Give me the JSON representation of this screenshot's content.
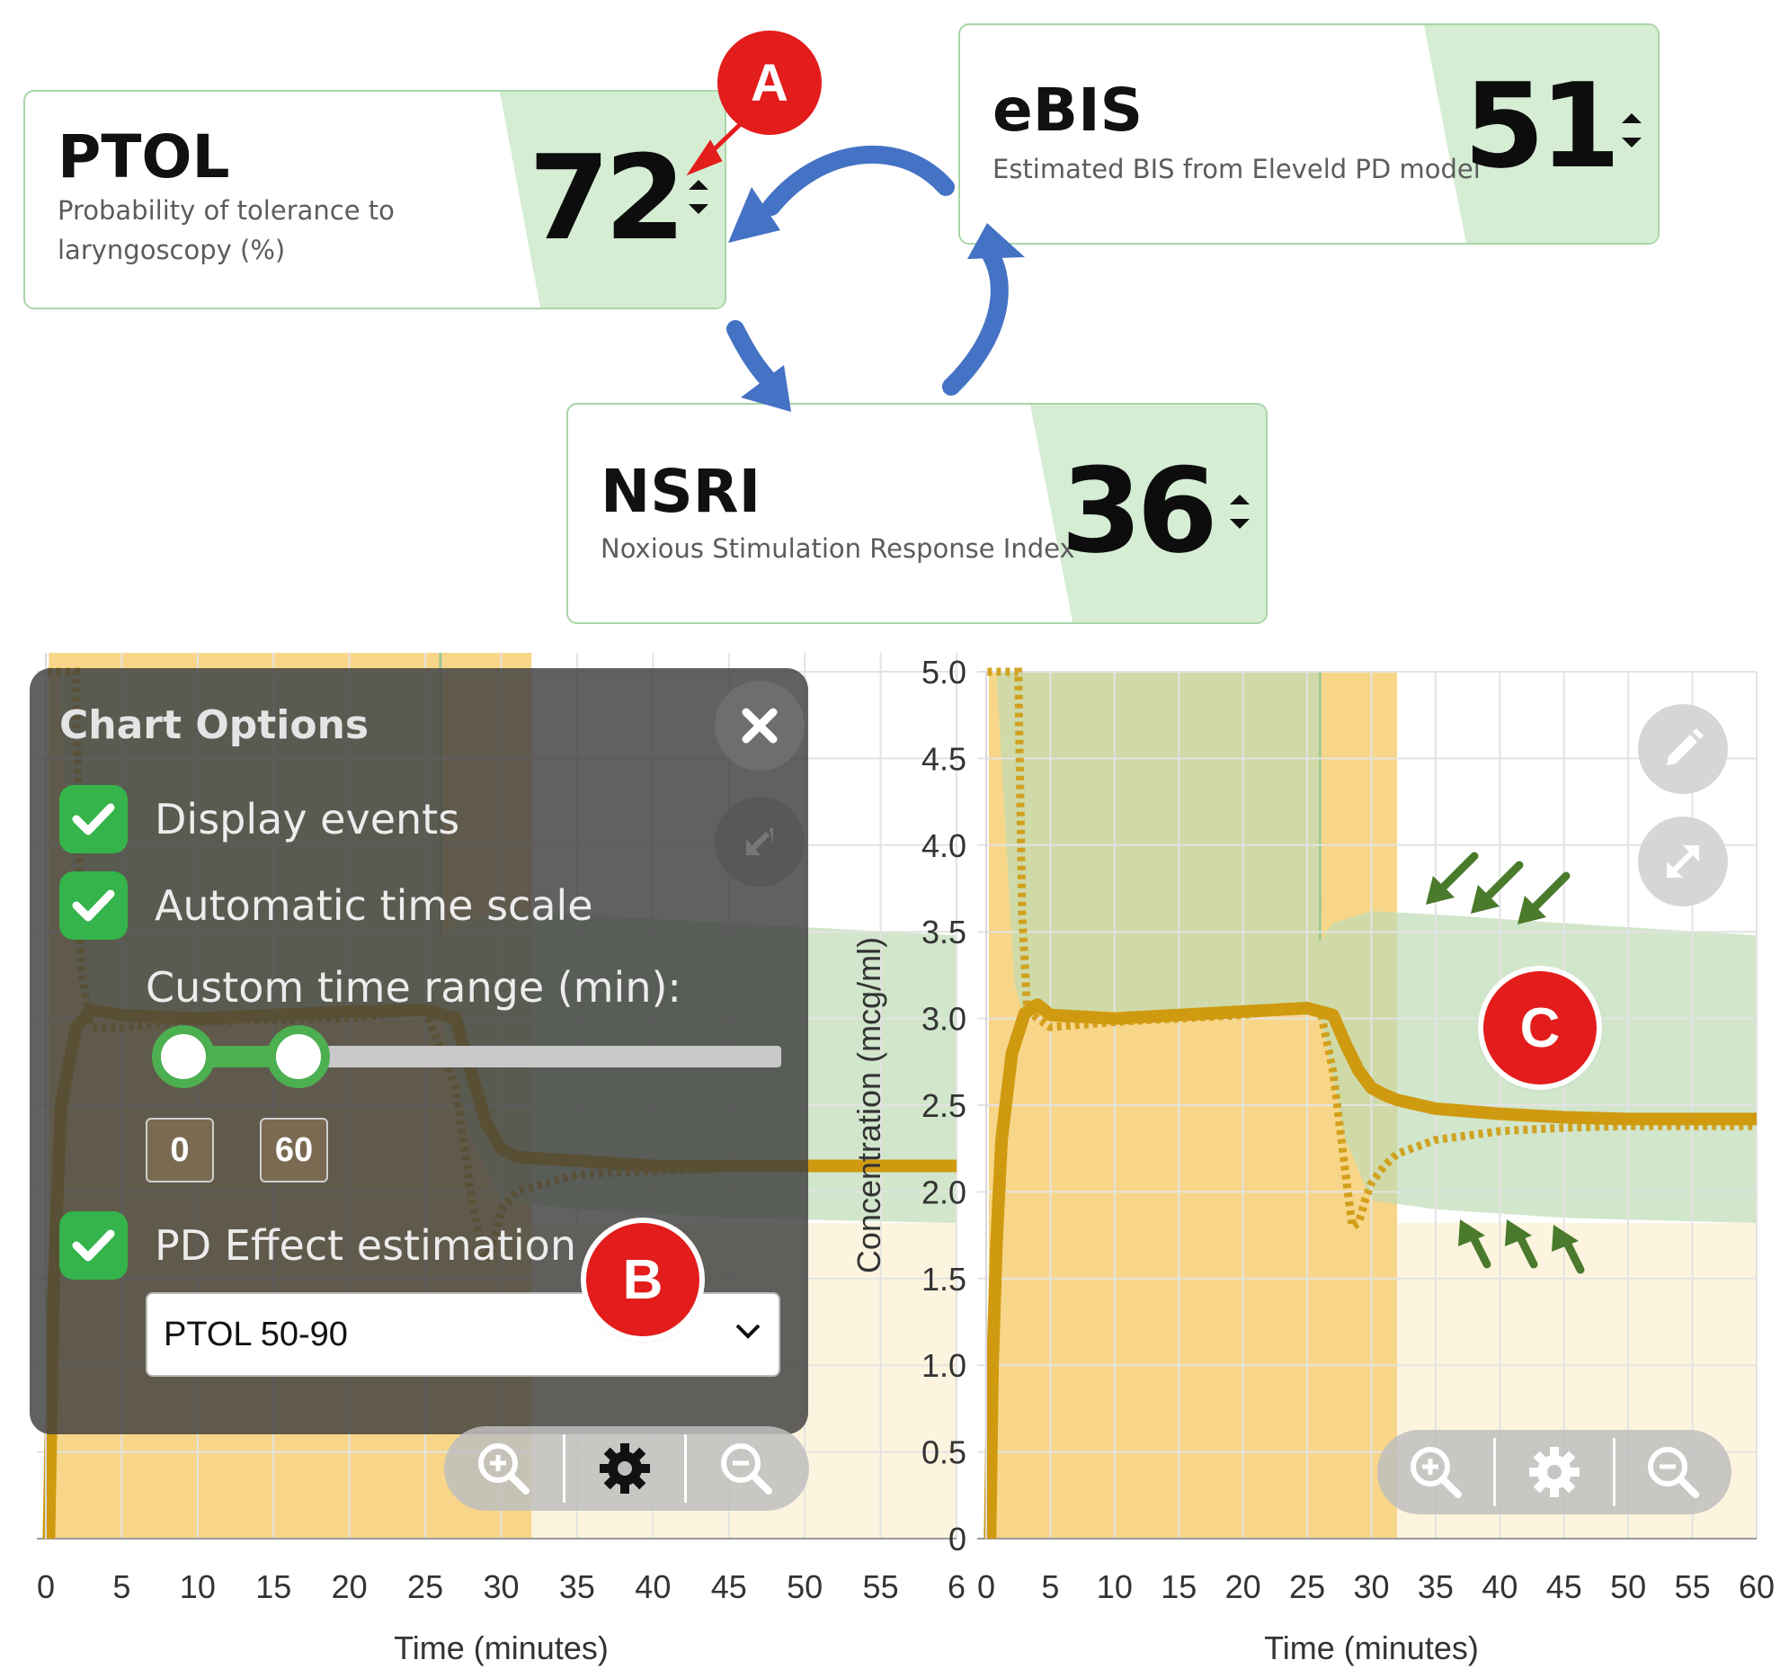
{
  "metrics": {
    "ptol": {
      "title": "PTOL",
      "subtitle_line1": "Probability of tolerance to",
      "subtitle_line2": "laryngoscopy (%)",
      "value": "72"
    },
    "ebis": {
      "title": "eBIS",
      "subtitle": "Estimated BIS from Eleveld PD model",
      "value": "51"
    },
    "nsri": {
      "title": "NSRI",
      "subtitle": "Noxious Stimulation Response Index",
      "value": "36"
    }
  },
  "callouts": {
    "a": "A",
    "b": "B",
    "c": "C"
  },
  "chart_options": {
    "title": "Chart Options",
    "display_events": "Display events",
    "automatic_time_scale": "Automatic time scale",
    "custom_time_range": "Custom time range (min):",
    "range_min": "0",
    "range_max": "60",
    "pd_effect_estimation": "PD Effect estimation",
    "pd_select_value": "PTOL 50-90"
  },
  "icons": {
    "close": "close-icon",
    "pencil": "pencil-icon",
    "expand": "expand-icon",
    "zoom_in": "zoom-in-icon",
    "gear": "gear-icon",
    "zoom_out": "zoom-out-icon",
    "check": "check-icon",
    "chevron": "chevron-down-icon"
  },
  "colors": {
    "card_border": "#a9d5a7",
    "card_green": "#d5edd3",
    "badge_red": "#e31c1c",
    "arrow_blue": "#4472c4",
    "band_green": "#bddcb5",
    "infusion_orange": "#f6cf74",
    "cp_line": "#cf9a10",
    "ce_line": "#f4c23c",
    "checkbox_green": "#34b44a",
    "hint_arrow": "#4a7a2c"
  },
  "chart_data": [
    {
      "type": "line",
      "xlabel": "Time (minutes)",
      "ylabel": "",
      "xlim": [
        0,
        60
      ],
      "x_ticks": [
        "0",
        "5",
        "10",
        "15",
        "20",
        "25",
        "30",
        "35",
        "40",
        "45",
        "50",
        "55",
        "6"
      ],
      "series": [
        {
          "x": [
            0.2,
            0.5,
            1,
            2,
            3,
            5,
            10,
            15,
            20,
            25,
            27,
            28,
            29,
            30,
            31,
            35,
            40,
            50,
            60
          ],
          "y": [
            0,
            1.4,
            2.5,
            2.95,
            3.05,
            3.02,
            3.0,
            3.02,
            3.04,
            3.05,
            3.0,
            2.7,
            2.4,
            2.25,
            2.2,
            2.18,
            2.15,
            2.15,
            2.15
          ]
        },
        {
          "x": [
            0.1,
            2,
            2.3,
            3,
            5,
            10,
            20,
            25,
            27,
            28,
            28.5,
            29,
            29.5,
            30,
            31,
            35,
            40,
            50,
            60
          ],
          "y": [
            5.0,
            5.0,
            3.3,
            2.95,
            2.95,
            2.98,
            3.0,
            3.05,
            2.6,
            2.0,
            1.75,
            1.6,
            1.7,
            1.9,
            2.0,
            2.1,
            2.12,
            2.15,
            2.15
          ]
        }
      ]
    },
    {
      "type": "line",
      "xlabel": "Time (minutes)",
      "ylabel": "Concentration (mcg/ml)",
      "xlim": [
        0,
        60
      ],
      "ylim": [
        0,
        5.0
      ],
      "x_ticks": [
        "0",
        "5",
        "10",
        "15",
        "20",
        "25",
        "30",
        "35",
        "40",
        "45",
        "50",
        "55",
        "60"
      ],
      "y_ticks": [
        "0",
        "0.5",
        "1.0",
        "1.5",
        "2.0",
        "2.5",
        "3.0",
        "3.5",
        "4.0",
        "4.5",
        "5.0"
      ],
      "series": [
        {
          "x": [
            0.3,
            0.5,
            0.8,
            1.2,
            2,
            3,
            4,
            5,
            10,
            15,
            20,
            25,
            27,
            28,
            29,
            30,
            31,
            32,
            35,
            40,
            45,
            50,
            55,
            60
          ],
          "y": [
            0,
            1.0,
            1.7,
            2.3,
            2.8,
            3.03,
            3.08,
            3.02,
            3.0,
            3.02,
            3.04,
            3.06,
            3.02,
            2.85,
            2.7,
            2.6,
            2.56,
            2.53,
            2.48,
            2.45,
            2.43,
            2.42,
            2.42,
            2.42
          ]
        },
        {
          "x": [
            0.1,
            2.5,
            2.8,
            3.2,
            4,
            5,
            10,
            20,
            25,
            26,
            27,
            28,
            28.5,
            29,
            29.5,
            30,
            31,
            32,
            35,
            40,
            45,
            50,
            55,
            60
          ],
          "y": [
            5.0,
            5.0,
            3.6,
            3.05,
            3.0,
            2.95,
            2.98,
            3.02,
            3.07,
            3.05,
            2.7,
            2.1,
            1.8,
            1.82,
            1.95,
            2.05,
            2.15,
            2.22,
            2.3,
            2.35,
            2.37,
            2.38,
            2.38,
            2.38
          ]
        }
      ],
      "bands": {
        "upper": 3.5,
        "lower": 2.0
      }
    }
  ]
}
